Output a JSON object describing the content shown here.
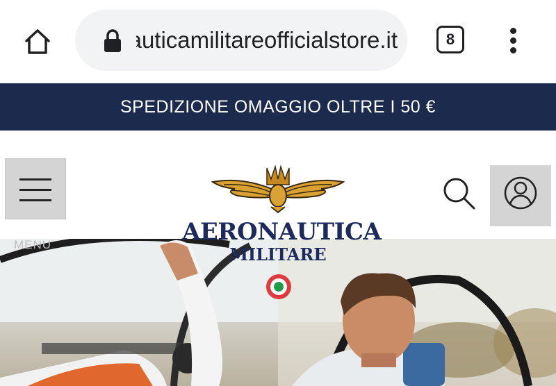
{
  "browser": {
    "url": "aeronauticamilitareofficialstore.it",
    "tab_count": "8",
    "icons": [
      "home-icon",
      "lock-icon",
      "tabs-icon",
      "more-vert-icon"
    ]
  },
  "promo": {
    "text": "SPEDIZIONE OMAGGIO OLTRE I 50 €"
  },
  "header": {
    "menu_label": "MENU",
    "brand_line1": "AERONAUTICA",
    "brand_line2": "MILITARE",
    "icons": [
      "hamburger-icon",
      "search-icon",
      "user-icon"
    ]
  },
  "colors": {
    "promo_bg": "#1b2a4d",
    "brand_navy": "#1d2a5d",
    "eagle_gold": "#d9a233"
  }
}
